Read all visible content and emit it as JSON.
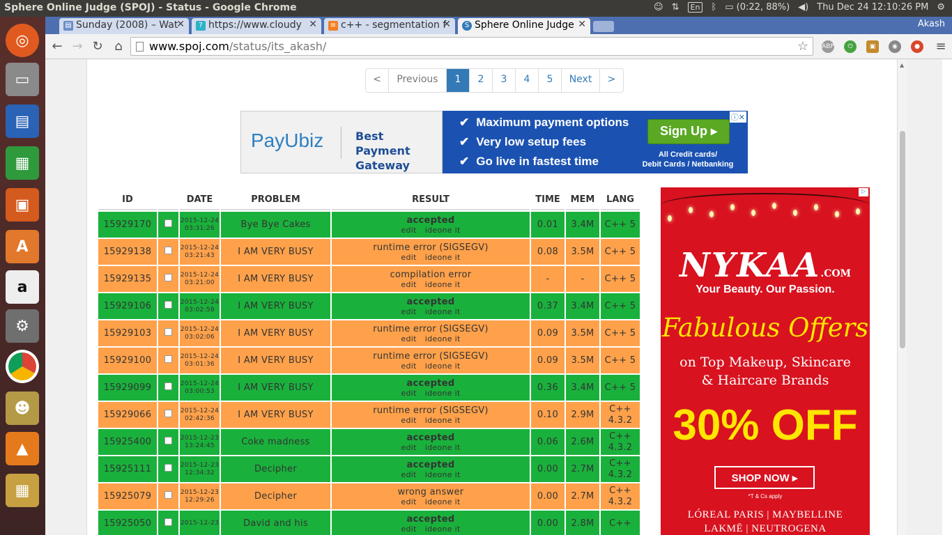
{
  "os_panel": {
    "window_title": "Sphere Online Judge (SPOJ) - Status - Google Chrome",
    "keyboard": "En",
    "battery": "(0:22, 88%)",
    "clock": "Thu Dec 24 12:10:26 PM"
  },
  "launcher": {
    "items": [
      "ubuntu-dash",
      "files",
      "writer",
      "calc",
      "impress",
      "software-center",
      "amazon",
      "system-settings",
      "chrome",
      "pidgin",
      "vlc",
      "screenshot"
    ]
  },
  "browser": {
    "tabs": [
      {
        "label": "Sunday (2008) – Wat",
        "active": false
      },
      {
        "label": "https://www.cloudy",
        "active": false
      },
      {
        "label": "c++ - segmentation f",
        "active": false
      },
      {
        "label": "Sphere Online Judge",
        "active": true
      }
    ],
    "profile": "Akash",
    "url_host": "www.spoj.com",
    "url_path": "/status/its_akash/"
  },
  "pagination": {
    "items": [
      "<",
      "Previous",
      "1",
      "2",
      "3",
      "4",
      "5",
      "Next",
      ">"
    ],
    "active": "1"
  },
  "ad_banner": {
    "brand": "PayUbiz",
    "tagline_1": "Best Payment",
    "tagline_2": "Gateway",
    "features": [
      "Maximum payment options",
      "Very low setup fees",
      "Go live in fastest time"
    ],
    "cta": "Sign Up ▸",
    "cards_1": "All Credit cards/",
    "cards_2": "Debit Cards / Netbanking",
    "ad_choices": "ⓘ✕"
  },
  "table": {
    "headers": {
      "id": "ID",
      "date": "DATE",
      "problem": "PROBLEM",
      "result": "RESULT",
      "time": "TIME",
      "mem": "MEM",
      "lang": "LANG"
    },
    "link_edit": "edit",
    "link_ideone": "ideone it",
    "rows": [
      {
        "id": "15929170",
        "date1": "2015-12-24",
        "date2": "03:31:26",
        "problem": "Bye Bye Cakes",
        "result": "accepted",
        "time": "0.01",
        "mem": "3.4M",
        "lang1": "C++ 5",
        "lang2": "",
        "status": "green"
      },
      {
        "id": "15929138",
        "date1": "2015-12-24",
        "date2": "03:21:43",
        "problem": "I AM VERY BUSY",
        "result": "runtime error (SIGSEGV)",
        "time": "0.08",
        "mem": "3.5M",
        "lang1": "C++ 5",
        "lang2": "",
        "status": "orange"
      },
      {
        "id": "15929135",
        "date1": "2015-12-24",
        "date2": "03:21:00",
        "problem": "I AM VERY BUSY",
        "result": "compilation error",
        "time": "-",
        "mem": "-",
        "lang1": "C++ 5",
        "lang2": "",
        "status": "orange"
      },
      {
        "id": "15929106",
        "date1": "2015-12-24",
        "date2": "03:02:58",
        "problem": "I AM VERY BUSY",
        "result": "accepted",
        "time": "0.37",
        "mem": "3.4M",
        "lang1": "C++ 5",
        "lang2": "",
        "status": "green"
      },
      {
        "id": "15929103",
        "date1": "2015-12-24",
        "date2": "03:02:06",
        "problem": "I AM VERY BUSY",
        "result": "runtime error (SIGSEGV)",
        "time": "0.09",
        "mem": "3.5M",
        "lang1": "C++ 5",
        "lang2": "",
        "status": "orange"
      },
      {
        "id": "15929100",
        "date1": "2015-12-24",
        "date2": "03:01:36",
        "problem": "I AM VERY BUSY",
        "result": "runtime error (SIGSEGV)",
        "time": "0.09",
        "mem": "3.5M",
        "lang1": "C++ 5",
        "lang2": "",
        "status": "orange"
      },
      {
        "id": "15929099",
        "date1": "2015-12-24",
        "date2": "03:00:53",
        "problem": "I AM VERY BUSY",
        "result": "accepted",
        "time": "0.36",
        "mem": "3.4M",
        "lang1": "C++ 5",
        "lang2": "",
        "status": "green"
      },
      {
        "id": "15929066",
        "date1": "2015-12-24",
        "date2": "02:42:36",
        "problem": "I AM VERY BUSY",
        "result": "runtime error (SIGSEGV)",
        "time": "0.10",
        "mem": "2.9M",
        "lang1": "C++",
        "lang2": "4.3.2",
        "status": "orange"
      },
      {
        "id": "15925400",
        "date1": "2015-12-23",
        "date2": "13:24:45",
        "problem": "Coke madness",
        "result": "accepted",
        "time": "0.06",
        "mem": "2.6M",
        "lang1": "C++",
        "lang2": "4.3.2",
        "status": "green"
      },
      {
        "id": "15925111",
        "date1": "2015-12-23",
        "date2": "12:34:32",
        "problem": "Decipher",
        "result": "accepted",
        "time": "0.00",
        "mem": "2.7M",
        "lang1": "C++",
        "lang2": "4.3.2",
        "status": "green"
      },
      {
        "id": "15925079",
        "date1": "2015-12-23",
        "date2": "12:29:26",
        "problem": "Decipher",
        "result": "wrong answer",
        "time": "0.00",
        "mem": "2.7M",
        "lang1": "C++",
        "lang2": "4.3.2",
        "status": "orange"
      },
      {
        "id": "15925050",
        "date1": "2015-12-23",
        "date2": "",
        "problem": "David and his",
        "result": "accepted",
        "time": "0.00",
        "mem": "2.8M",
        "lang1": "C++",
        "lang2": "",
        "status": "green"
      }
    ]
  },
  "side_ad": {
    "logo": "NYKAA",
    "logo_suffix": ".COM",
    "subtitle": "Your Beauty. Our Passion.",
    "headline": "Fabulous Offers",
    "line1": "on Top Makeup, Skincare",
    "line2": "& Haircare Brands",
    "discount": "30% OFF",
    "cta": "SHOP NOW ▸",
    "terms": "*T & Cs apply",
    "brands1": "LÓREAL PARIS | MAYBELLINE",
    "brands2": "LAKMĒ | NEUTROGENA"
  },
  "colors": {
    "accepted": "#19b13c",
    "error": "#ffa14a",
    "pagination_active": "#337ab7",
    "ad_blue": "#1b52b2",
    "nykaa_red": "#d8121f"
  }
}
